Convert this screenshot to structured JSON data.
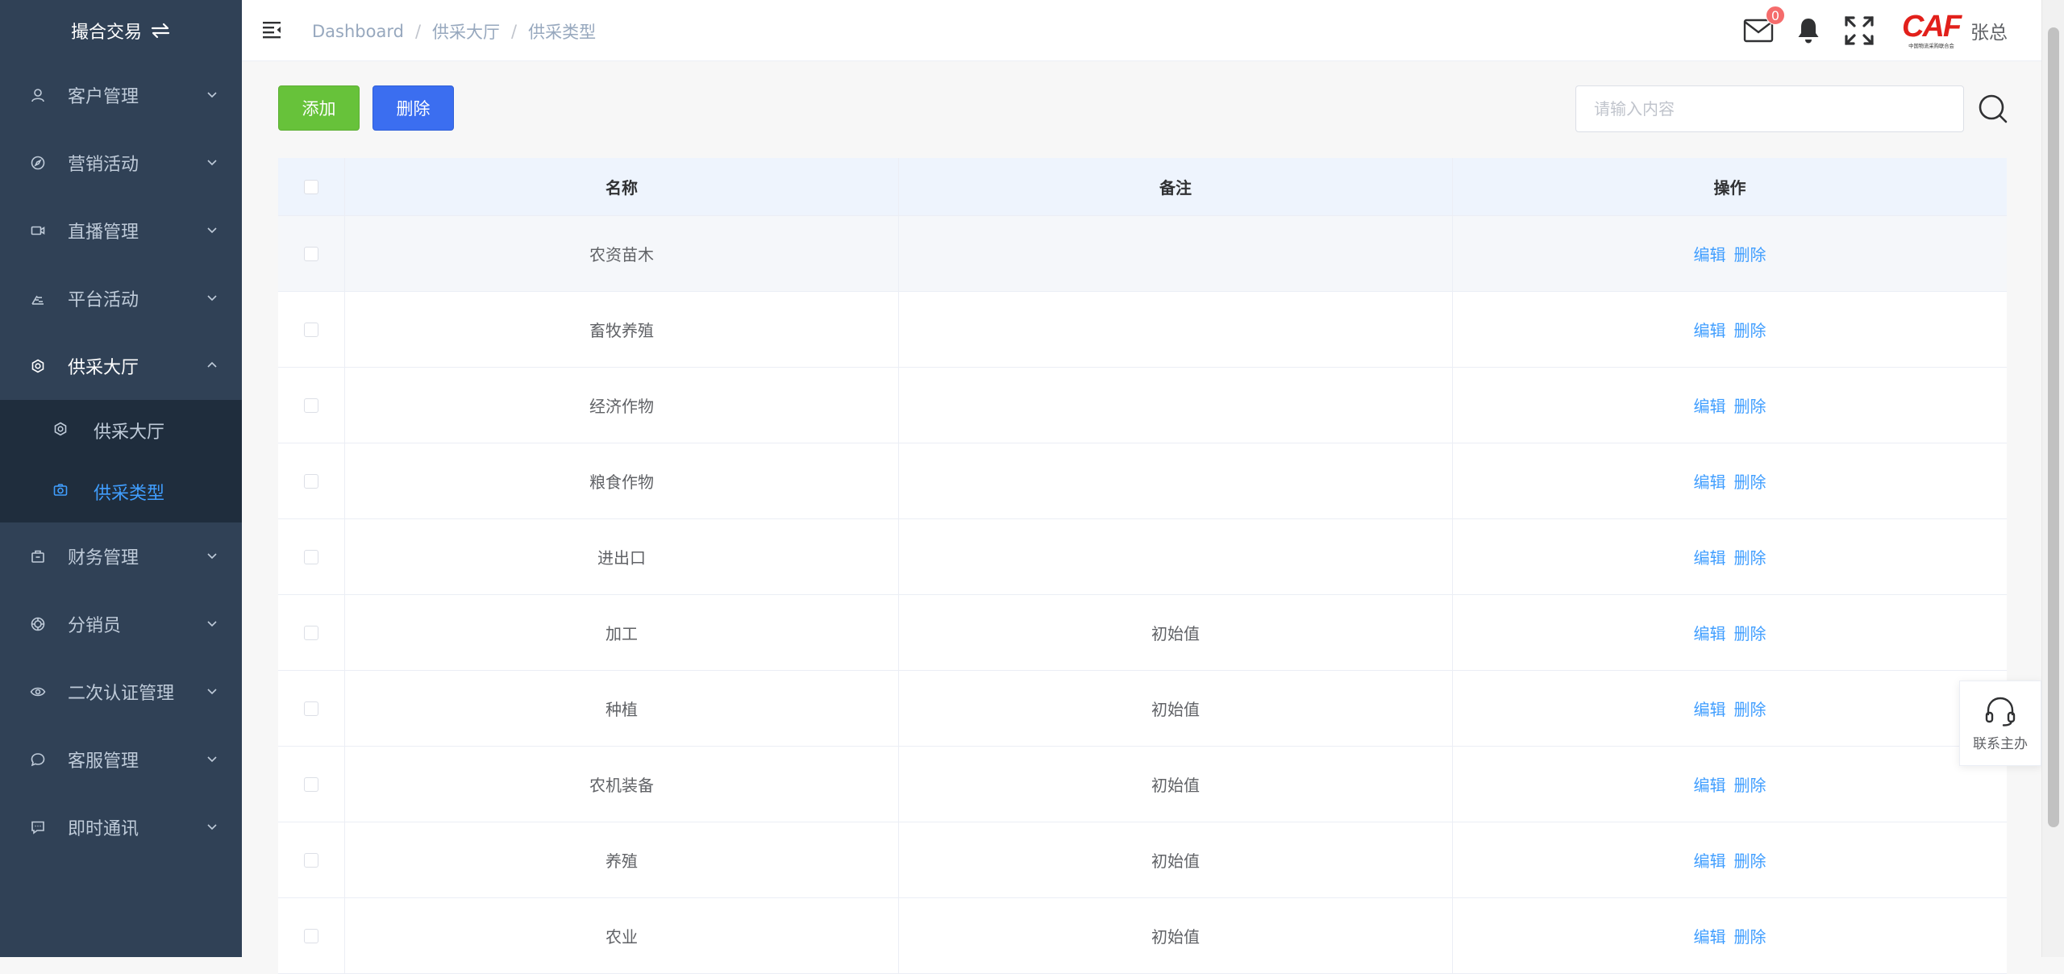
{
  "sidebar": {
    "title": "撮合交易",
    "items": [
      {
        "label": "客户管理",
        "icon": "user-icon"
      },
      {
        "label": "营销活动",
        "icon": "compass-icon"
      },
      {
        "label": "直播管理",
        "icon": "video-camera-icon"
      },
      {
        "label": "平台活动",
        "icon": "chart-icon"
      },
      {
        "label": "供采大厅",
        "icon": "gear-icon"
      },
      {
        "label": "财务管理",
        "icon": "briefcase-icon"
      },
      {
        "label": "分销员",
        "icon": "target-icon"
      },
      {
        "label": "二次认证管理",
        "icon": "eye-icon"
      },
      {
        "label": "客服管理",
        "icon": "chat-bubble-icon"
      },
      {
        "label": "即时通讯",
        "icon": "message-icon"
      }
    ],
    "submenu": [
      {
        "label": "供采大厅",
        "icon": "gear-icon"
      },
      {
        "label": "供采类型",
        "icon": "camera-icon"
      }
    ]
  },
  "header": {
    "breadcrumb": [
      "Dashboard",
      "供采大厅",
      "供采类型"
    ],
    "mail_badge": "0",
    "logo_text": "CAF",
    "logo_subtext": "中国物流采购联合会",
    "username": "张总"
  },
  "toolbar": {
    "add_label": "添加",
    "delete_label": "删除",
    "search_placeholder": "请输入内容"
  },
  "table": {
    "columns": [
      "名称",
      "备注",
      "操作"
    ],
    "rows": [
      {
        "name": "农资苗木",
        "note": ""
      },
      {
        "name": "畜牧养殖",
        "note": ""
      },
      {
        "name": "经济作物",
        "note": ""
      },
      {
        "name": "粮食作物",
        "note": ""
      },
      {
        "name": "进出口",
        "note": ""
      },
      {
        "name": "加工",
        "note": "初始值"
      },
      {
        "name": "种植",
        "note": "初始值"
      },
      {
        "name": "农机装备",
        "note": "初始值"
      },
      {
        "name": "养殖",
        "note": "初始值"
      },
      {
        "name": "农业",
        "note": "初始值"
      }
    ],
    "edit_label": "编辑",
    "delete_label": "删除"
  },
  "contact": {
    "label": "联系主办"
  },
  "colors": {
    "sidebar_bg": "#304156",
    "submenu_bg": "#1f2d3d",
    "active": "#409eff",
    "add_button": "#67c23a",
    "delete_button": "#3b6ef0",
    "badge": "#f56c6c",
    "logo": "#e2201b"
  }
}
